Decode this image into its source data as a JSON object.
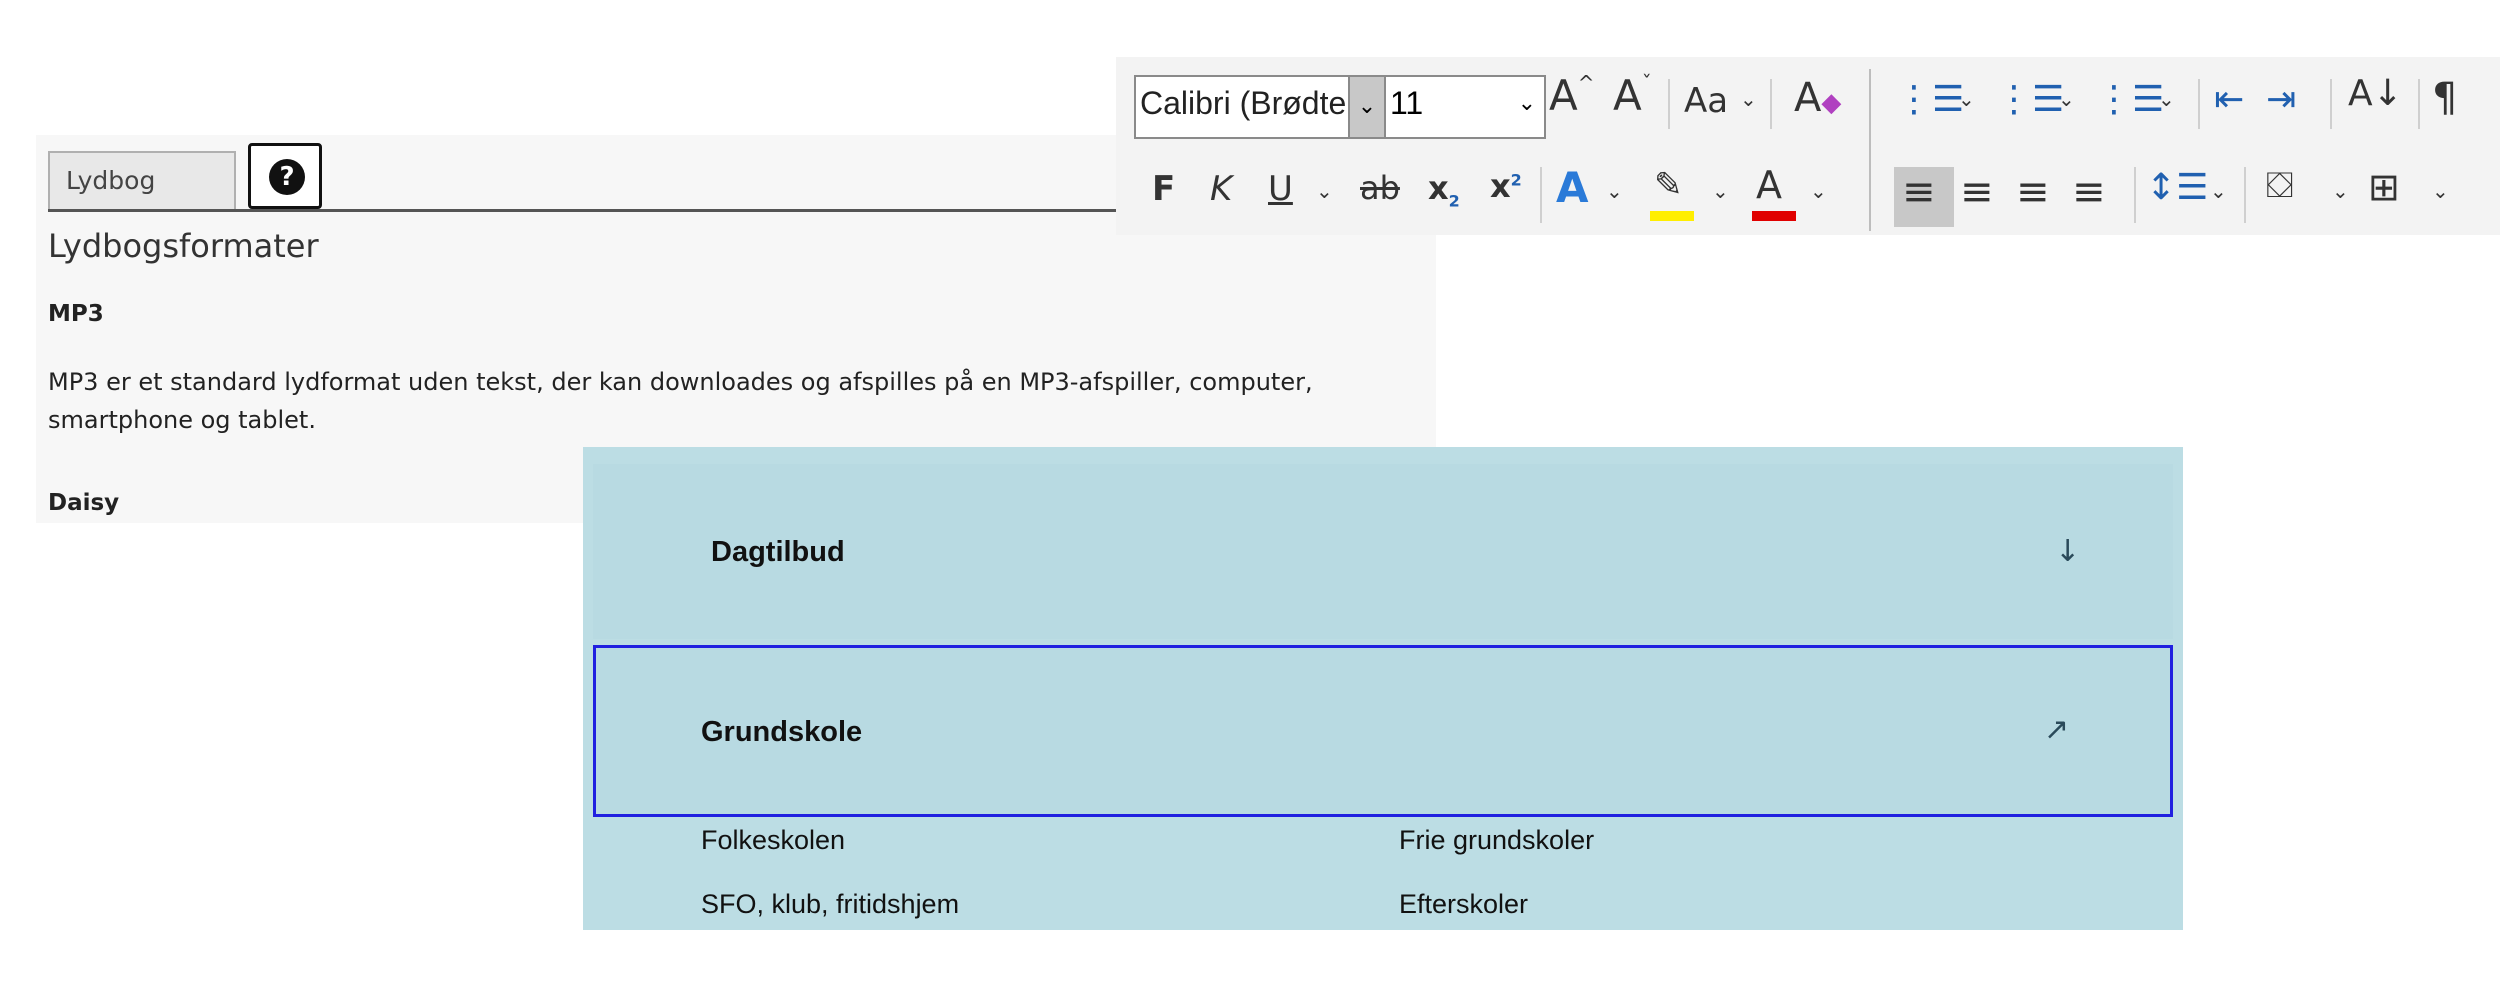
{
  "audiobook": {
    "tab_label": "Lydbog",
    "help_glyph": "?",
    "heading": "Lydbogsformater",
    "mp3_heading": "MP3",
    "mp3_text": "MP3 er et standard lydformat uden tekst, der kan downloades og afspilles på en MP3-afspiller, computer, smartphone og tablet.",
    "daisy_heading": "Daisy"
  },
  "ribbon": {
    "font_name": "Calibri (Brødte",
    "font_size": "11",
    "bold": "F",
    "italic": "K",
    "underline": "U",
    "strike": "ab",
    "change_case": "Aa",
    "paragraph": "¶",
    "highlight_color": "#ffee00",
    "font_color": "#e00000"
  },
  "schools": {
    "row1_title": "Dagtilbud",
    "row1_arrow": "↓",
    "row2_title": "Grundskole",
    "row2_arrow": "↗",
    "links": [
      "Folkeskolen",
      "Frie grundskoler",
      "SFO, klub, fritidshjem",
      "Efterskoler"
    ]
  }
}
